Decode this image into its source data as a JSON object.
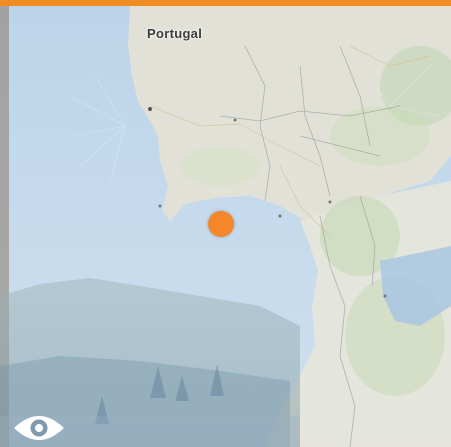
{
  "map": {
    "country_label": "Portugal",
    "marker_icon": "location-dot",
    "toggle_icon": "eye-icon"
  },
  "colors": {
    "accent": "#f08c22",
    "marker": "#f5862a",
    "ocean": "#c2d8ea",
    "land": "#e6e4d8",
    "icon_white": "#ffffff"
  }
}
